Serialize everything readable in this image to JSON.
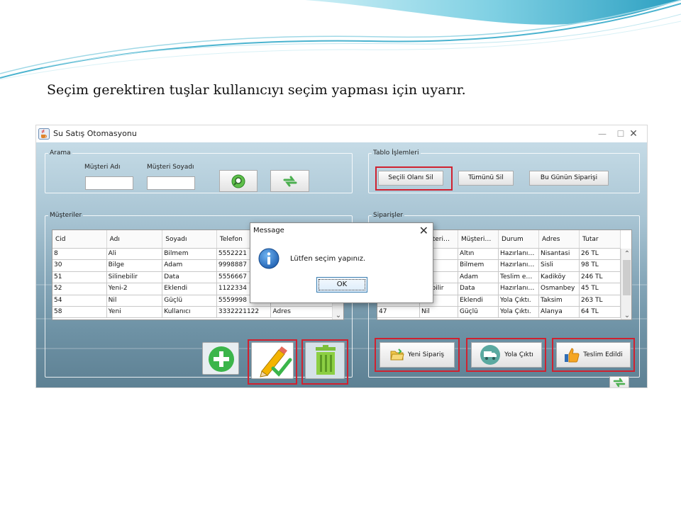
{
  "slide": {
    "title": "Seçim gerektiren tuşlar kullanıcıyı seçim yapması için uyarır."
  },
  "window": {
    "title": "Su Satış Otomasyonu",
    "minimize": "—",
    "maximize": "☐",
    "close": "✕"
  },
  "search": {
    "legend": "Arama",
    "first_name_label": "Müşteri Adı",
    "last_name_label": "Müşteri Soyadı",
    "first_name_value": "",
    "last_name_value": "",
    "search_icon": "magnifier-icon",
    "refresh_icon": "refresh-icon"
  },
  "table_ops": {
    "legend": "Tablo İşlemleri",
    "delete_selected": "Seçili Olanı Sil",
    "delete_all": "Tümünü Sil",
    "today_orders": "Bu Günün Siparişi"
  },
  "customers": {
    "legend": "Müşteriler",
    "columns": [
      "Cid",
      "Adı",
      "Soyadı",
      "Telefon",
      ""
    ],
    "rows": [
      [
        "8",
        "Ali",
        "Bilmem",
        "5552221",
        ""
      ],
      [
        "30",
        "Bilge",
        "Adam",
        "9998887",
        ""
      ],
      [
        "51",
        "Silinebilir",
        "Data",
        "5556667",
        ""
      ],
      [
        "52",
        "Yeni-2",
        "Eklendi",
        "1122334",
        ""
      ],
      [
        "54",
        "Nil",
        "Güçlü",
        "5559998",
        ""
      ],
      [
        "58",
        "Yeni",
        "Kullanıcı",
        "3332221122",
        "Adres"
      ]
    ],
    "add_icon": "plus-icon",
    "edit_icon": "pencil-check-icon",
    "delete_icon": "trash-icon"
  },
  "orders": {
    "legend": "Siparişler",
    "columns": [
      "",
      "…şteri…",
      "Müşteri…",
      "Durum",
      "Adres",
      "Tutar"
    ],
    "rows": [
      [
        "",
        "…t",
        "Altın",
        "Hazırlanı…",
        "Nisantasi",
        "26 TL"
      ],
      [
        "",
        "",
        "Bilmem",
        "Hazırlanı…",
        "Sisli",
        "98 TL"
      ],
      [
        "",
        "",
        "Adam",
        "Teslim e…",
        "Kadiköy",
        "246 TL"
      ],
      [
        "",
        "…ebilir",
        "Data",
        "Hazırlanı…",
        "Osmanbey",
        "45 TL"
      ],
      [
        "",
        "…2",
        "Eklendi",
        "Yola Çıktı.",
        "Taksim",
        "263 TL"
      ],
      [
        "47",
        "Nil",
        "Güçlü",
        "Yola Çıktı.",
        "Alanya",
        "64 TL"
      ]
    ],
    "new_order": "Yeni Sipariş",
    "on_the_way": "Yola Çıktı",
    "delivered": "Teslim Edildi",
    "new_order_icon": "folder-open-icon",
    "truck_icon": "truck-icon",
    "thumbs_up_icon": "thumbs-up-icon",
    "refresh_icon": "refresh-icon"
  },
  "dialog": {
    "title": "Message",
    "message": "Lütfen seçim yapınız.",
    "ok": "OK",
    "icon": "info-icon"
  },
  "colors": {
    "highlight": "#d0212f",
    "add_green": "#3bb54a",
    "info_blue": "#1f6fc8",
    "wave_teal": "#4ab3cf"
  }
}
